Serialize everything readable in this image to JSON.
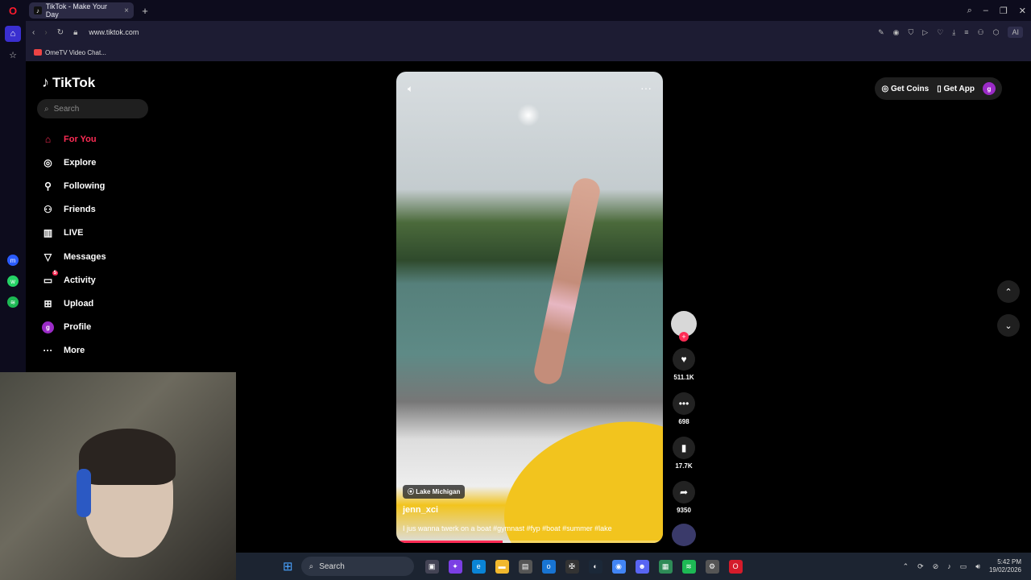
{
  "browser": {
    "tab_title": "TikTok - Make Your Day",
    "url": "www.tiktok.com",
    "bookmark": "OmeTV Video Chat...",
    "ai_label": "AI"
  },
  "tiktok": {
    "logo": "TikTok",
    "search_placeholder": "Search",
    "nav": [
      {
        "label": "For You",
        "icon": "home-icon"
      },
      {
        "label": "Explore",
        "icon": "compass-icon"
      },
      {
        "label": "Following",
        "icon": "user-follow-icon"
      },
      {
        "label": "Friends",
        "icon": "friends-icon"
      },
      {
        "label": "LIVE",
        "icon": "live-icon"
      },
      {
        "label": "Messages",
        "icon": "send-icon"
      },
      {
        "label": "Activity",
        "icon": "activity-icon",
        "badge": "5"
      },
      {
        "label": "Upload",
        "icon": "upload-icon"
      },
      {
        "label": "Profile",
        "icon": "avatar-g",
        "avatar": "g"
      },
      {
        "label": "More",
        "icon": "more-icon"
      }
    ],
    "get_coins": "Get Coins",
    "get_app": "Get App",
    "user_initial": "g",
    "video": {
      "location": "Lake Michigan",
      "author": "jenn_xci",
      "caption": "I jus wanna twerk on a boat #gymnast #fyp #boat #summer #lake",
      "progress": 0.4,
      "likes": "511.1K",
      "comments": "698",
      "saves": "17.7K",
      "shares": "9350"
    }
  },
  "taskbar": {
    "search": "Search",
    "time": "5:42 PM",
    "date": "19/02/2026"
  },
  "colors": {
    "accent": "#fe2c55",
    "browser_bg": "#0d0c1d",
    "taskbar_bg": "#1c2431"
  }
}
